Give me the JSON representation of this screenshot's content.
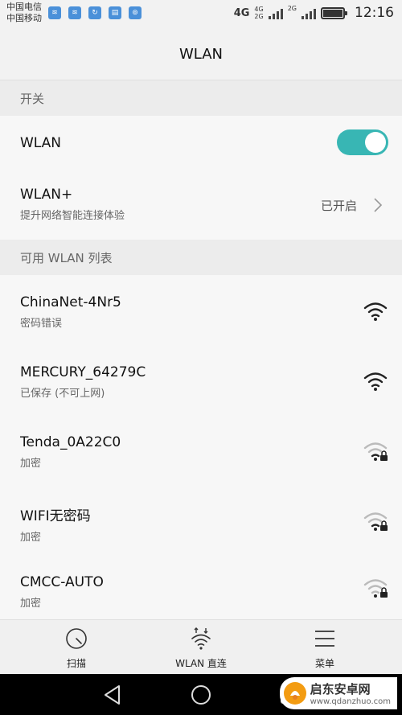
{
  "status_bar": {
    "carrier_1": "中国电信",
    "carrier_2": "中国移动",
    "network_label": "4G",
    "network_sub_1": "4G",
    "network_sub_2": "2G",
    "network_label_2": "2G",
    "time": "12:16"
  },
  "header": {
    "title": "WLAN"
  },
  "sections": {
    "switch_header": "开关",
    "available_header": "可用 WLAN 列表"
  },
  "wlan_toggle": {
    "label": "WLAN",
    "enabled": true,
    "color": "#38b6b4"
  },
  "wlan_plus": {
    "label": "WLAN+",
    "description": "提升网络智能连接体验",
    "status": "已开启"
  },
  "networks": [
    {
      "name": "ChinaNet-4Nr5",
      "status": "密码错误",
      "icon": "wifi-strong-icon"
    },
    {
      "name": "MERCURY_64279C",
      "status": "已保存 (不可上网)",
      "icon": "wifi-strong-icon"
    },
    {
      "name": "Tenda_0A22C0",
      "status": "加密",
      "icon": "wifi-locked-icon"
    },
    {
      "name": "WIFI无密码",
      "status": "加密",
      "icon": "wifi-locked-icon"
    },
    {
      "name": "CMCC-AUTO",
      "status": "加密",
      "icon": "wifi-weak-locked-icon"
    }
  ],
  "bottom_tabs": {
    "scan": "扫描",
    "direct": "WLAN 直连",
    "menu": "菜单"
  },
  "watermark": {
    "text": "启东安卓网",
    "domain": "www.qdanzhuo.com"
  }
}
